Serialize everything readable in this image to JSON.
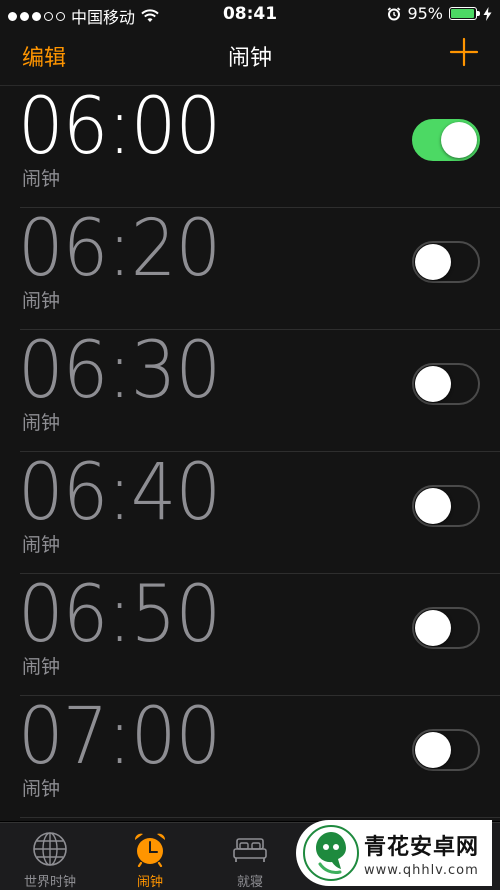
{
  "status_bar": {
    "carrier": "中国移动",
    "time": "08:41",
    "battery_percent": "95%",
    "battery_level": 0.95,
    "signal_bars_filled": 3,
    "signal_bars_total": 5
  },
  "navbar": {
    "edit_label": "编辑",
    "title": "闹钟",
    "add_icon": "plus-icon"
  },
  "alarms": [
    {
      "time": "06:00",
      "label": "闹钟",
      "enabled": true
    },
    {
      "time": "06:20",
      "label": "闹钟",
      "enabled": false
    },
    {
      "time": "06:30",
      "label": "闹钟",
      "enabled": false
    },
    {
      "time": "06:40",
      "label": "闹钟",
      "enabled": false
    },
    {
      "time": "06:50",
      "label": "闹钟",
      "enabled": false
    },
    {
      "time": "07:00",
      "label": "闹钟",
      "enabled": false
    }
  ],
  "tabbar": {
    "tabs": [
      {
        "label": "世界时钟",
        "icon": "globe-icon",
        "active": false
      },
      {
        "label": "闹钟",
        "icon": "alarm-clock-icon",
        "active": true
      },
      {
        "label": "就寝",
        "icon": "bed-icon",
        "active": false
      }
    ]
  },
  "watermark": {
    "title": "青花安卓网",
    "url": "www.qhhlv.com"
  },
  "colors": {
    "accent": "#ff9500",
    "toggle_on": "#4cd964",
    "background": "#141414",
    "inactive_text": "#8e8e93"
  }
}
